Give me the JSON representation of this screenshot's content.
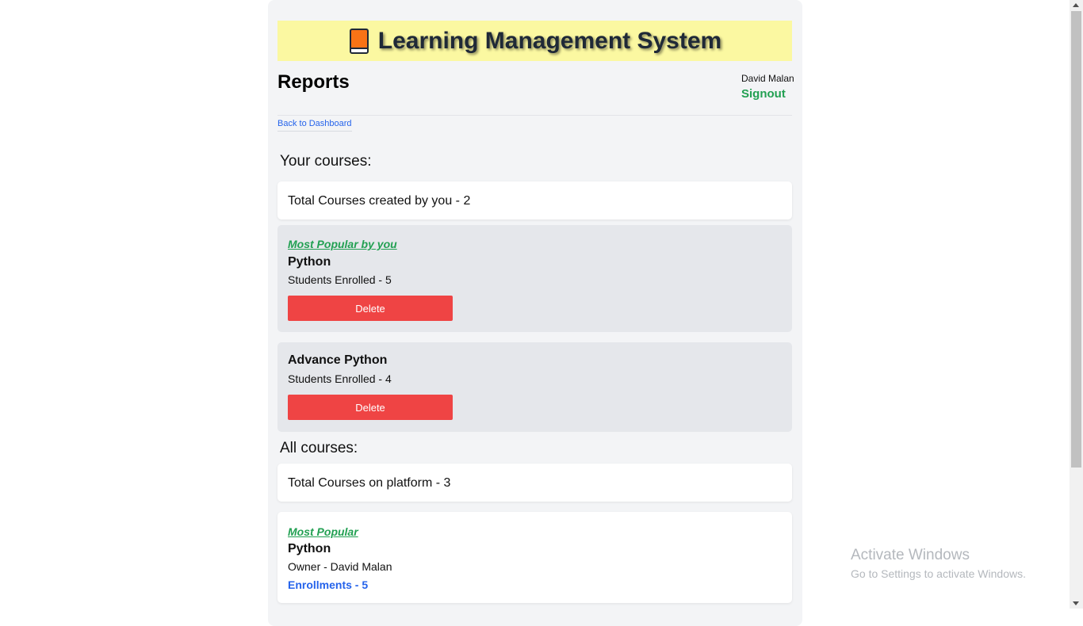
{
  "header": {
    "app_title": "Learning Management System",
    "icon": "orange-book-icon"
  },
  "page": {
    "title": "Reports",
    "back_link": "Back to Dashboard"
  },
  "user": {
    "name": "David Malan",
    "signout_label": "Signout"
  },
  "your_courses": {
    "heading": "Your courses:",
    "total_text": "Total Courses created by you - 2",
    "courses": [
      {
        "badge": "Most Popular by you",
        "name": "Python",
        "enrolled": "Students Enrolled - 5",
        "delete_label": "Delete"
      },
      {
        "name": "Advance Python",
        "enrolled": "Students Enrolled - 4",
        "delete_label": "Delete"
      }
    ]
  },
  "all_courses": {
    "heading": "All courses:",
    "total_text": "Total Courses on platform - 3",
    "courses": [
      {
        "badge": "Most Popular",
        "name": "Python",
        "owner": "Owner - David Malan",
        "enrollments": "Enrollments - 5"
      }
    ]
  },
  "watermark": {
    "title": "Activate Windows",
    "subtitle": "Go to Settings to activate Windows."
  },
  "colors": {
    "banner_bg": "#fbf8a1",
    "accent_green": "#22a052",
    "link_blue": "#2563eb",
    "delete_red": "#ef4444"
  }
}
